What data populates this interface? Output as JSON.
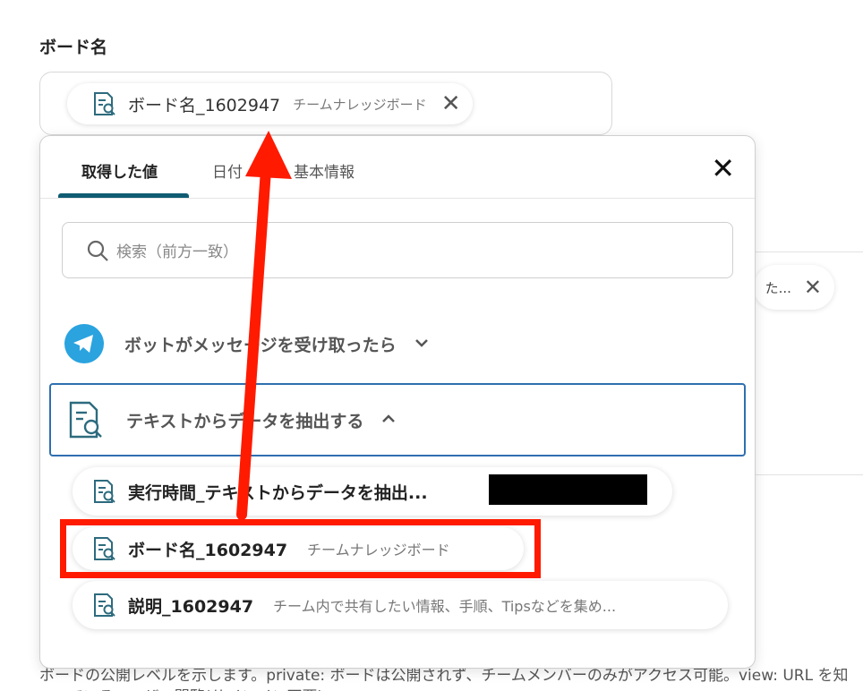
{
  "field": {
    "label": "ボード名",
    "chip_name": "ボード名_1602947",
    "chip_sub": "チームナレッジボード"
  },
  "background": {
    "chip_text": "た...",
    "description_line1": "ボードの公開レベルを示します。private: ボードは公開されず、チームメンバーのみがアクセス可能。view: URL を知",
    "description_line2": "っているユーザー閲覧(サインイン不要)"
  },
  "panel": {
    "tabs": [
      "取得した値",
      "日付",
      "基本情報"
    ],
    "search_placeholder": "検索（前方一致）",
    "groups": [
      {
        "label": "ボットがメッセージを受け取ったら",
        "icon": "telegram-icon",
        "expanded": false
      },
      {
        "label": "テキストからデータを抽出する",
        "icon": "document-search-icon",
        "expanded": true
      }
    ],
    "items": [
      {
        "name": "実行時間_テキストからデータを抽出...",
        "sub": ""
      },
      {
        "name": "ボード名_1602947",
        "sub": "チームナレッジボード"
      },
      {
        "name": "説明_1602947",
        "sub": "チーム内で共有したい情報、手順、Tipsなどを集め..."
      }
    ]
  },
  "colors": {
    "accent": "#0f5c73",
    "selection_border": "#2f6fb0",
    "annotation_red": "#ff1a00",
    "telegram_blue": "#2aa3df"
  }
}
